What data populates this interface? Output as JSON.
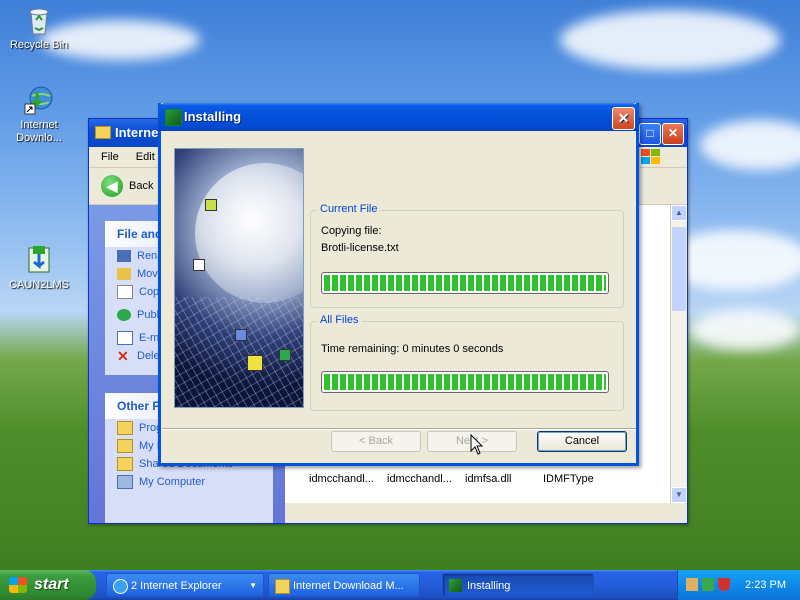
{
  "desktop": {
    "icons": [
      {
        "label": "Recycle Bin",
        "icon": "recycle-bin-icon"
      },
      {
        "label": "Internet Downlo...",
        "icon": "idm-shortcut-icon"
      },
      {
        "label": "CAUN2LMS",
        "icon": "installer-icon"
      }
    ]
  },
  "explorer": {
    "title": "Internet Download Manager",
    "menu": [
      "File",
      "Edit"
    ],
    "back_label": "Back",
    "sidebar": {
      "file_tasks_title": "File and Folder Tasks",
      "file_tasks": [
        "Rename this file",
        "Move this file",
        "Copy this file",
        "Publish this file to the Web",
        "E-mail this file",
        "Delete this file"
      ],
      "other_places_title": "Other Places",
      "other_places": [
        "Program Files",
        "My Documents",
        "Shared Documents",
        "My Computer"
      ]
    },
    "files": [
      "idmcchandl...",
      "idmcchandl...",
      "idmfsa.dll",
      "IDMFType"
    ]
  },
  "dialog": {
    "title": "Installing",
    "current_file": {
      "legend": "Current File",
      "line1": "Copying file:",
      "line2": "Brotli-license.txt",
      "progress": 1.0
    },
    "all_files": {
      "legend": "All Files",
      "line1": "Time remaining: 0 minutes 0 seconds",
      "progress": 1.0
    },
    "buttons": {
      "back": "< Back",
      "next": "Next >",
      "cancel": "Cancel"
    }
  },
  "taskbar": {
    "start_label": "start",
    "tasks": [
      {
        "label": "2 Internet Explorer",
        "icon": "ie-icon"
      },
      {
        "label": "Internet Download M...",
        "icon": "folder-icon"
      },
      {
        "label": "Installing",
        "icon": "installer-icon"
      }
    ],
    "clock": "2:23 PM"
  },
  "colors": {
    "xp_blue": "#0054e3",
    "progress_green": "#2fc22f",
    "group_legend": "#0046d5"
  }
}
